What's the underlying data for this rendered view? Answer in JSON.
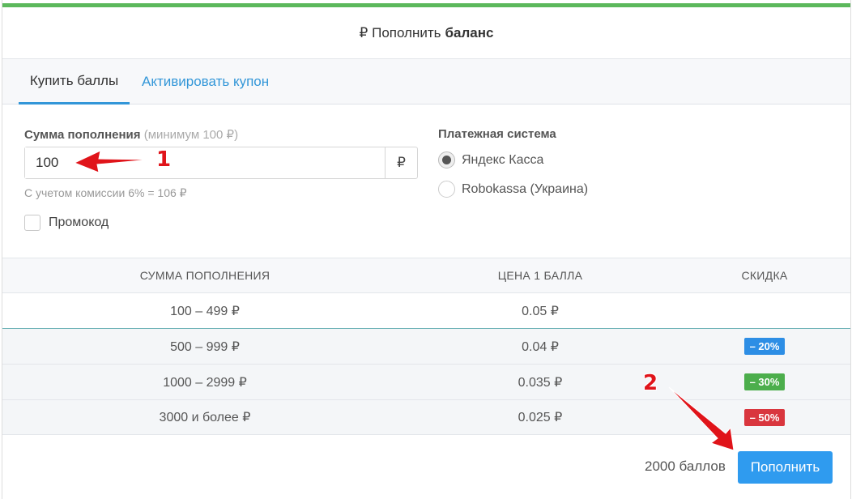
{
  "colors": {
    "top_bar": "#5cb85c",
    "link_blue": "#3296d8",
    "badge_blue": "#2d8ee5",
    "badge_green": "#4cae4c",
    "badge_red": "#d9363e",
    "submit_blue": "#2f9bef",
    "annotation_red": "#e0141a"
  },
  "header": {
    "currency_symbol": "₽",
    "title_prefix": "Пополнить",
    "title_bold": "баланс"
  },
  "tabs": [
    {
      "label": "Купить баллы",
      "active": true
    },
    {
      "label": "Активировать купон",
      "active": false
    }
  ],
  "amount": {
    "label": "Сумма пополнения",
    "hint": "(минимум 100 ₽)",
    "value": "100",
    "addon": "₽",
    "commission": "С учетом комиссии 6% = 106 ₽"
  },
  "promo": {
    "label": "Промокод",
    "checked": false
  },
  "payment": {
    "label": "Платежная система",
    "options": [
      {
        "label": "Яндекс Касса",
        "selected": true
      },
      {
        "label": "Robokassa (Украина)",
        "selected": false
      }
    ]
  },
  "table": {
    "headers": [
      "Сумма пополнения",
      "Цена 1 балла",
      "Скидка"
    ],
    "rows": [
      {
        "range": "100 – 499 ₽",
        "price": "0.05 ₽",
        "discount": ""
      },
      {
        "range": "500 – 999 ₽",
        "price": "0.04 ₽",
        "discount": "– 20%"
      },
      {
        "range": "1000 – 2999 ₽",
        "price": "0.035 ₽",
        "discount": "– 30%"
      },
      {
        "range": "3000 и более ₽",
        "price": "0.025 ₽",
        "discount": "– 50%"
      }
    ]
  },
  "footer": {
    "total": "2000 баллов",
    "submit_label": "Пополнить"
  },
  "annotations": {
    "step1": "1",
    "step2": "2"
  }
}
